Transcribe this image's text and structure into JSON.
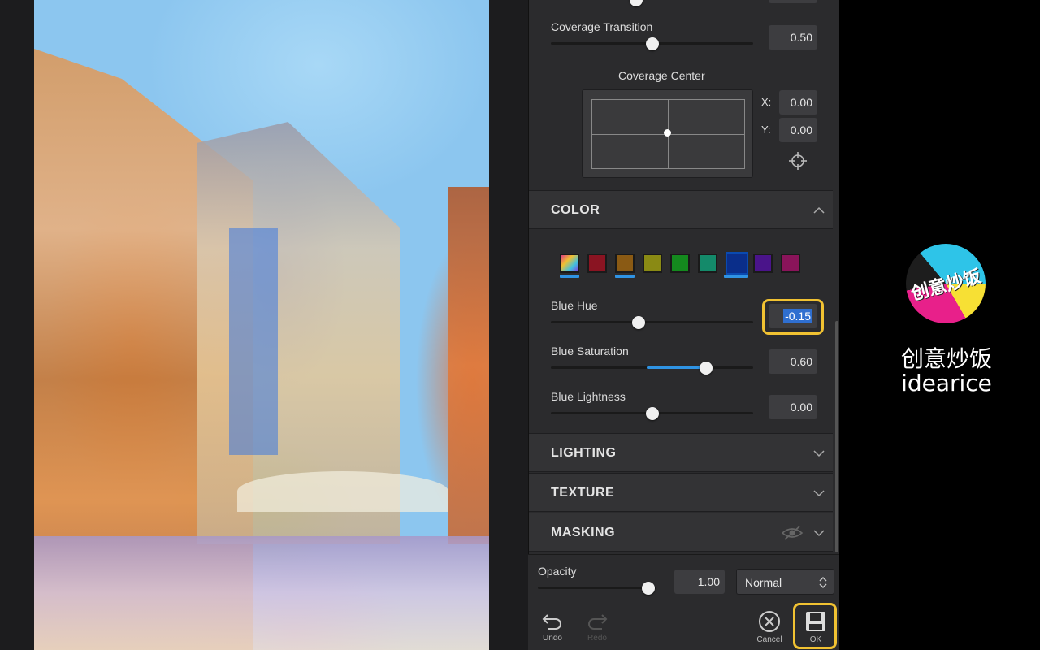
{
  "coverage_transition": {
    "label": "Coverage Transition",
    "value": "0.50",
    "level": 0.5
  },
  "coverage_center": {
    "label": "Coverage Center",
    "x_label": "X:",
    "x_value": "0.00",
    "y_label": "Y:",
    "y_value": "0.00"
  },
  "color_section": {
    "title": "COLOR",
    "swatches": [
      {
        "name": "all",
        "color": "#8a6cc0"
      },
      {
        "name": "red",
        "color": "#8a1422"
      },
      {
        "name": "orange",
        "color": "#8a5a14"
      },
      {
        "name": "yellow",
        "color": "#8a8a14"
      },
      {
        "name": "green",
        "color": "#148a1e"
      },
      {
        "name": "aqua",
        "color": "#148a6a"
      },
      {
        "name": "blue",
        "color": "#0a2e8a"
      },
      {
        "name": "purple",
        "color": "#4a148a"
      },
      {
        "name": "magenta",
        "color": "#8a145a"
      }
    ],
    "blue_hue": {
      "label": "Blue Hue",
      "value": "-0.15",
      "level": -0.15
    },
    "blue_saturation": {
      "label": "Blue Saturation",
      "value": "0.60",
      "level": 0.6
    },
    "blue_lightness": {
      "label": "Blue Lightness",
      "value": "0.00",
      "level": 0.0
    }
  },
  "sections": {
    "lighting": "LIGHTING",
    "texture": "TEXTURE",
    "masking": "MASKING"
  },
  "opacity": {
    "label": "Opacity",
    "value": "1.00",
    "level": 1.0
  },
  "blend_mode": {
    "value": "Normal"
  },
  "toolbar": {
    "undo": "Undo",
    "redo": "Redo",
    "cancel": "Cancel",
    "ok": "OK"
  },
  "brand": {
    "cn": "创意炒饭",
    "en": "idearice",
    "logo_text": "创意炒饭"
  },
  "colors": {
    "accent": "#2f93e3",
    "highlight": "#f1c232",
    "panel": "#2b2b2d"
  }
}
